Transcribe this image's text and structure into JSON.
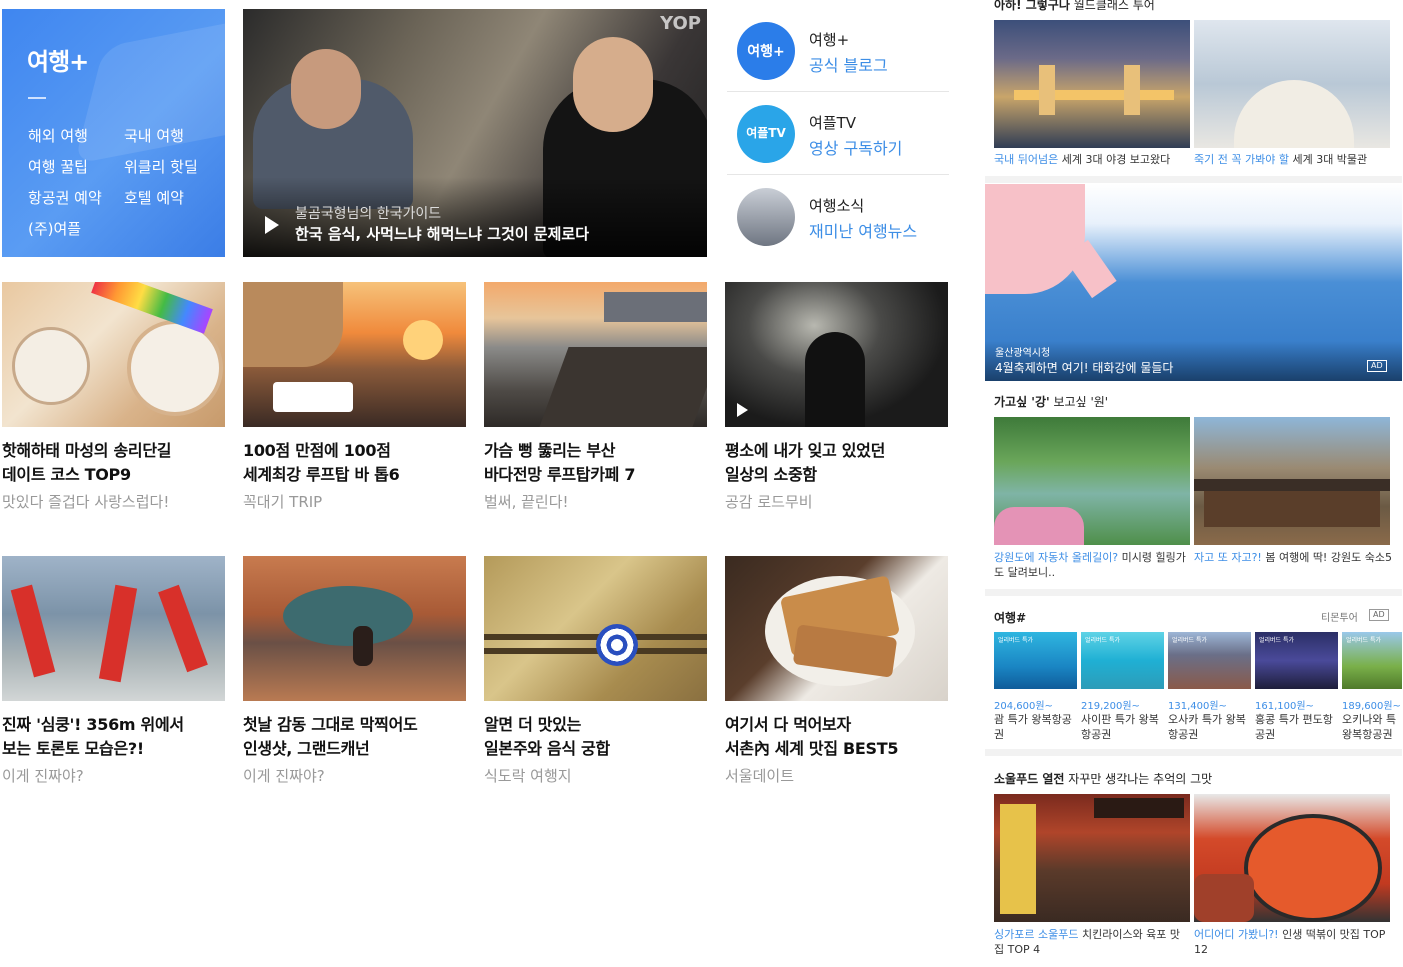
{
  "hero": {
    "logo": "여행+",
    "menu": [
      "해외 여행",
      "국내 여행",
      "여행 꿀팁",
      "위클리 핫딜",
      "항공권 예약",
      "호텔 예약",
      "(주)여플"
    ]
  },
  "video": {
    "watermark": "YOP",
    "subtitle": "불곰국형님의 한국가이드",
    "title": "한국 음식, 사먹느냐 해먹느냐 그것이 문제로다"
  },
  "channels": [
    {
      "name": "여행+",
      "link": "공식 블로그",
      "icon_text": "여행+",
      "color": "#2b7de9"
    },
    {
      "name": "여플TV",
      "link": "영상 구독하기",
      "icon_text": "여플TV",
      "color": "#2aa5e8"
    },
    {
      "name": "여행소식",
      "link": "재미난 여행뉴스",
      "icon_text": "",
      "color": "#8a8f99"
    }
  ],
  "cards": [
    {
      "title1": "핫해하태 마성의 송리단길",
      "title2": "데이트 코스 TOP9",
      "source": "맛있다 즐겁다 사랑스럽다!"
    },
    {
      "title1": "100점 만점에 100점",
      "title2": "세계최강 루프탑 바 톱6",
      "source": "꼭대기 TRIP"
    },
    {
      "title1": "가슴 뻥 뚫리는 부산",
      "title2": "바다전망 루프탑카페 7",
      "source": "벌써, 끝린다!"
    },
    {
      "title1": "평소에 내가 잊고 있었던",
      "title2": "일상의 소중함",
      "source": "공감 로드무비"
    },
    {
      "title1": "진짜 '심쿵'! 356m 위에서",
      "title2": "보는 토론토 모습은?!",
      "source": "이게 진짜야?"
    },
    {
      "title1": "첫날 감동 그대로 막찍어도",
      "title2": "인생샷, 그랜드캐넌",
      "source": "이게 진짜야?"
    },
    {
      "title1": "알면 더 맛있는",
      "title2": "일본주와 음식 궁합",
      "source": "식도락 여행지"
    },
    {
      "title1": "여기서 다 먹어보자",
      "title2": "서촌內 세계 맛집 BEST5",
      "source": "서울데이트"
    }
  ],
  "sidebar": {
    "section1": {
      "header_bold": "아하! 그렇구나",
      "header_rest": "월드클래스 투어",
      "items": [
        {
          "blue": "국내 뒤어넘은",
          "rest": "세계 3대 야경 보고왔다"
        },
        {
          "blue": "죽기 전 꼭 가봐야 할",
          "rest": "세계 3대 박물관"
        }
      ]
    },
    "banner": {
      "line1": "울산광역시청",
      "line2": "4월축제하면 여기! 태화강에 물들다",
      "ad": "AD"
    },
    "section2": {
      "header_bold": "가고싶 '강'",
      "header_rest": "보고싶 '원'",
      "items": [
        {
          "blue": "강원도에 자동차 올레길이?",
          "rest": "미시령 힐링가도 달려보니.."
        },
        {
          "blue": "자고 또 자고?!",
          "rest": "봄 여행에 딱! 강원도 숙소5"
        }
      ]
    },
    "section3": {
      "header": "여행#",
      "brand": "티몬투어",
      "ad": "AD",
      "deals": [
        {
          "price": "204,600원~",
          "name": "괌 특가 왕복항공권",
          "tag": "얼리버드 특가"
        },
        {
          "price": "219,200원~",
          "name": "사이판 특가 왕복항공권",
          "tag": "얼리버드 특가"
        },
        {
          "price": "131,400원~",
          "name": "오사카 특가 왕복항공권",
          "tag": "얼리버드 특가"
        },
        {
          "price": "161,100원~",
          "name": "홍콩 특가 편도항공권",
          "tag": "얼리버드 특가"
        },
        {
          "price": "189,600원~",
          "name": "오키나와 특 왕복항공권",
          "tag": "얼리버드 특가"
        }
      ]
    },
    "section4": {
      "header_bold": "소울푸드 열전",
      "header_rest": "자꾸만 생각나는 추억의 그맛",
      "items": [
        {
          "blue": "싱가포르 소울푸드",
          "rest": "치킨라이스와 육포 맛집 TOP 4"
        },
        {
          "blue": "어디어디 가봤니?!",
          "rest": "인생 떡볶이 맛집 TOP 12"
        }
      ]
    }
  }
}
